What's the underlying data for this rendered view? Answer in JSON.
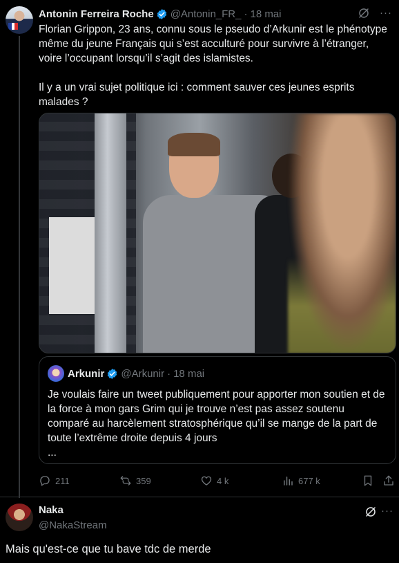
{
  "tweet": {
    "author": {
      "name": "Antonin Ferreira Roche",
      "handle": "@Antonin_FR_",
      "verified": true
    },
    "separator": "·",
    "date": "18 mai",
    "paragraphs": [
      "Florian Grippon, 23 ans, connu sous le pseudo d’Arkunir est le phénotype même du jeune Français qui s’est acculturé pour survivre à l’étranger, voire l’occupant lorsqu’il s’agit des islamistes.",
      "Il y a un vrai sujet politique ici : comment sauver ces jeunes esprits malades ?"
    ],
    "quote": {
      "author": {
        "name": "Arkunir",
        "handle": "@Arkunir",
        "verified": true
      },
      "date": "18 mai",
      "text": "Je voulais faire un tweet publiquement pour apporter mon soutien et de la force à mon gars Grim qui je trouve n’est pas assez soutenu comparé au harcèlement stratosphérique qu’il se mange de la part de toute l’extrême droite depuis 4 jours",
      "ellipsis": "..."
    },
    "stats": {
      "replies": "211",
      "reposts": "359",
      "likes": "4 k",
      "views": "677 k"
    },
    "more": "···"
  },
  "reply": {
    "author": {
      "name": "Naka",
      "handle": "@NakaStream"
    },
    "text": "Mais qu'est-ce que tu bave tdc de merde",
    "more": "···"
  },
  "colors": {
    "background": "#000000",
    "text": "#e7e9ea",
    "secondary": "#71767b",
    "verified": "#1d9bf0",
    "border": "#2f3336"
  },
  "icons": [
    "grok-icon",
    "more-icon",
    "verified-badge-icon",
    "reply-icon",
    "repost-icon",
    "like-icon",
    "views-icon",
    "bookmark-icon",
    "share-icon"
  ]
}
